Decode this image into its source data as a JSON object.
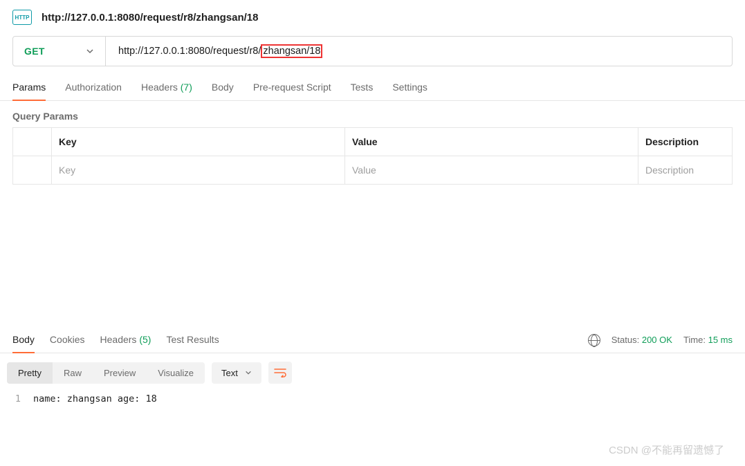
{
  "header": {
    "title": "http://127.0.0.1:8080/request/r8/zhangsan/18"
  },
  "request": {
    "method": "GET",
    "url_prefix": "http://127.0.0.1:8080/request/r8/",
    "url_highlighted": "zhangsan/18"
  },
  "tabs": {
    "params": "Params",
    "authorization": "Authorization",
    "headers": "Headers",
    "headers_count": "(7)",
    "body": "Body",
    "prerequest": "Pre-request Script",
    "tests": "Tests",
    "settings": "Settings"
  },
  "query": {
    "title": "Query Params",
    "key_header": "Key",
    "value_header": "Value",
    "desc_header": "Description",
    "key_ph": "Key",
    "value_ph": "Value",
    "desc_ph": "Description"
  },
  "response": {
    "tabs": {
      "body": "Body",
      "cookies": "Cookies",
      "headers": "Headers",
      "headers_count": "(5)",
      "testresults": "Test Results"
    },
    "status_label": "Status:",
    "status_value": "200 OK",
    "time_label": "Time:",
    "time_value": "15 ms",
    "viewmodes": {
      "pretty": "Pretty",
      "raw": "Raw",
      "preview": "Preview",
      "visualize": "Visualize"
    },
    "format": "Text",
    "code": {
      "line_no": "1",
      "content": "name: zhangsan age: 18"
    }
  },
  "watermark": "CSDN @不能再留遗憾了"
}
